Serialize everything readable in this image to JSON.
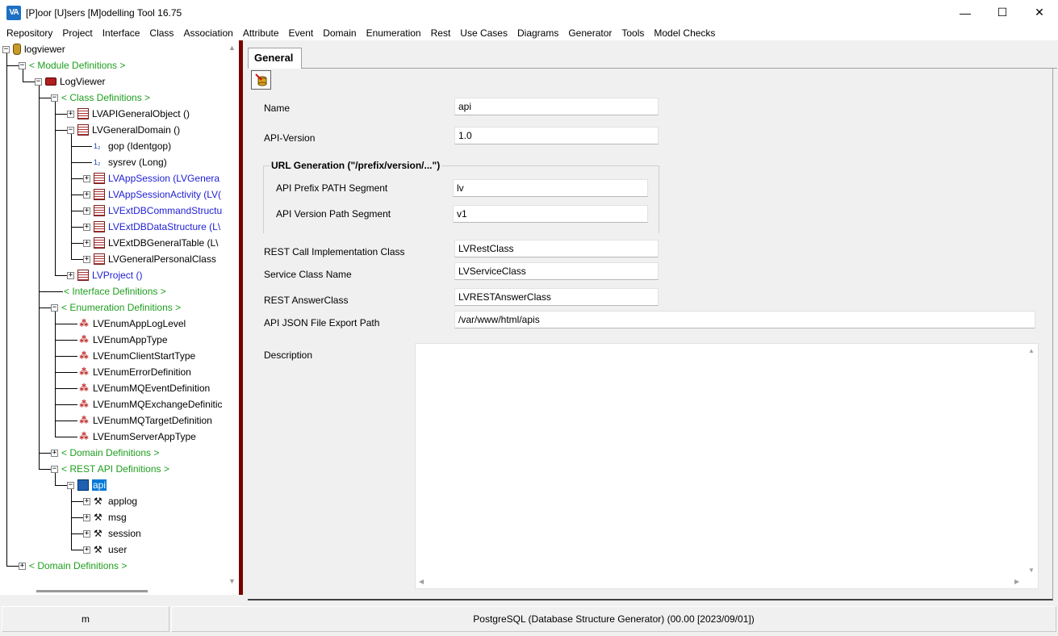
{
  "window": {
    "title": "[P]oor [U]sers [M]odelling Tool 16.75",
    "app_icon_text": "VA",
    "minimize": "—",
    "maximize": "☐",
    "close": "✕"
  },
  "menu": [
    "Repository",
    "Project",
    "Interface",
    "Class",
    "Association",
    "Attribute",
    "Event",
    "Domain",
    "Enumeration",
    "Rest",
    "Use Cases",
    "Diagrams",
    "Generator",
    "Tools",
    "Model Checks"
  ],
  "tree": {
    "root": "logviewer",
    "module_definitions": "< Module Definitions >",
    "module": "LogViewer",
    "class_definitions": "< Class Definitions >",
    "class_api_general_object": "LVAPIGeneralObject ()",
    "class_general_domain": "LVGeneralDomain ()",
    "attr_gop": "gop (Identgop)",
    "attr_sysrev": "sysrev (Long)",
    "sub_app_session": "LVAppSession (LVGenera",
    "sub_app_session_activity": "LVAppSessionActivity (LV(",
    "sub_ext_db_command": "LVExtDBCommandStructu",
    "sub_ext_db_data": "LVExtDBDataStructure (L\\",
    "sub_ext_db_general_table": "LVExtDBGeneralTable (L\\",
    "sub_general_personal": "LVGeneralPersonalClass",
    "class_project": "LVProject ()",
    "interface_definitions": "< Interface Definitions >",
    "enumeration_definitions": "< Enumeration Definitions >",
    "enums": [
      "LVEnumAppLogLevel",
      "LVEnumAppType",
      "LVEnumClientStartType",
      "LVEnumErrorDefinition",
      "LVEnumMQEventDefinition",
      "LVEnumMQExchangeDefinitic",
      "LVEnumMQTargetDefinition",
      "LVEnumServerAppType"
    ],
    "domain_definitions": "< Domain Definitions >",
    "rest_api_definitions": "< REST API Definitions >",
    "api": "api",
    "api_paths": [
      "applog",
      "msg",
      "session",
      "user"
    ],
    "root_domain_definitions": "< Domain Definitions >",
    "attr_icon_text": "1₂"
  },
  "tab": {
    "label": "General"
  },
  "form": {
    "name_label": "Name",
    "name_value": "api",
    "api_version_label": "API-Version",
    "api_version_value": "1.0",
    "url_group_title": "URL Generation (\"/prefix/version/...\")",
    "prefix_label": "API Prefix PATH Segment",
    "prefix_value": "lv",
    "version_path_label": "API Version Path Segment",
    "version_path_value": "v1",
    "rest_impl_label": "REST Call Implementation Class",
    "rest_impl_value": "LVRestClass",
    "service_label": "Service Class Name",
    "service_value": "LVServiceClass",
    "answer_label": "REST AnswerClass",
    "answer_value": "LVRESTAnswerClass",
    "export_label": "API JSON File Export Path",
    "export_value": "/var/www/html/apis",
    "description_label": "Description",
    "description_value": ""
  },
  "status": {
    "left": "m",
    "right": "PostgreSQL (Database Structure Generator) (00.00 [2023/09/01])"
  },
  "colors": {
    "splitter": "#7a0000",
    "selection": "#0078d7",
    "green": "#1e9e1e",
    "blue": "#1d1dd6"
  }
}
